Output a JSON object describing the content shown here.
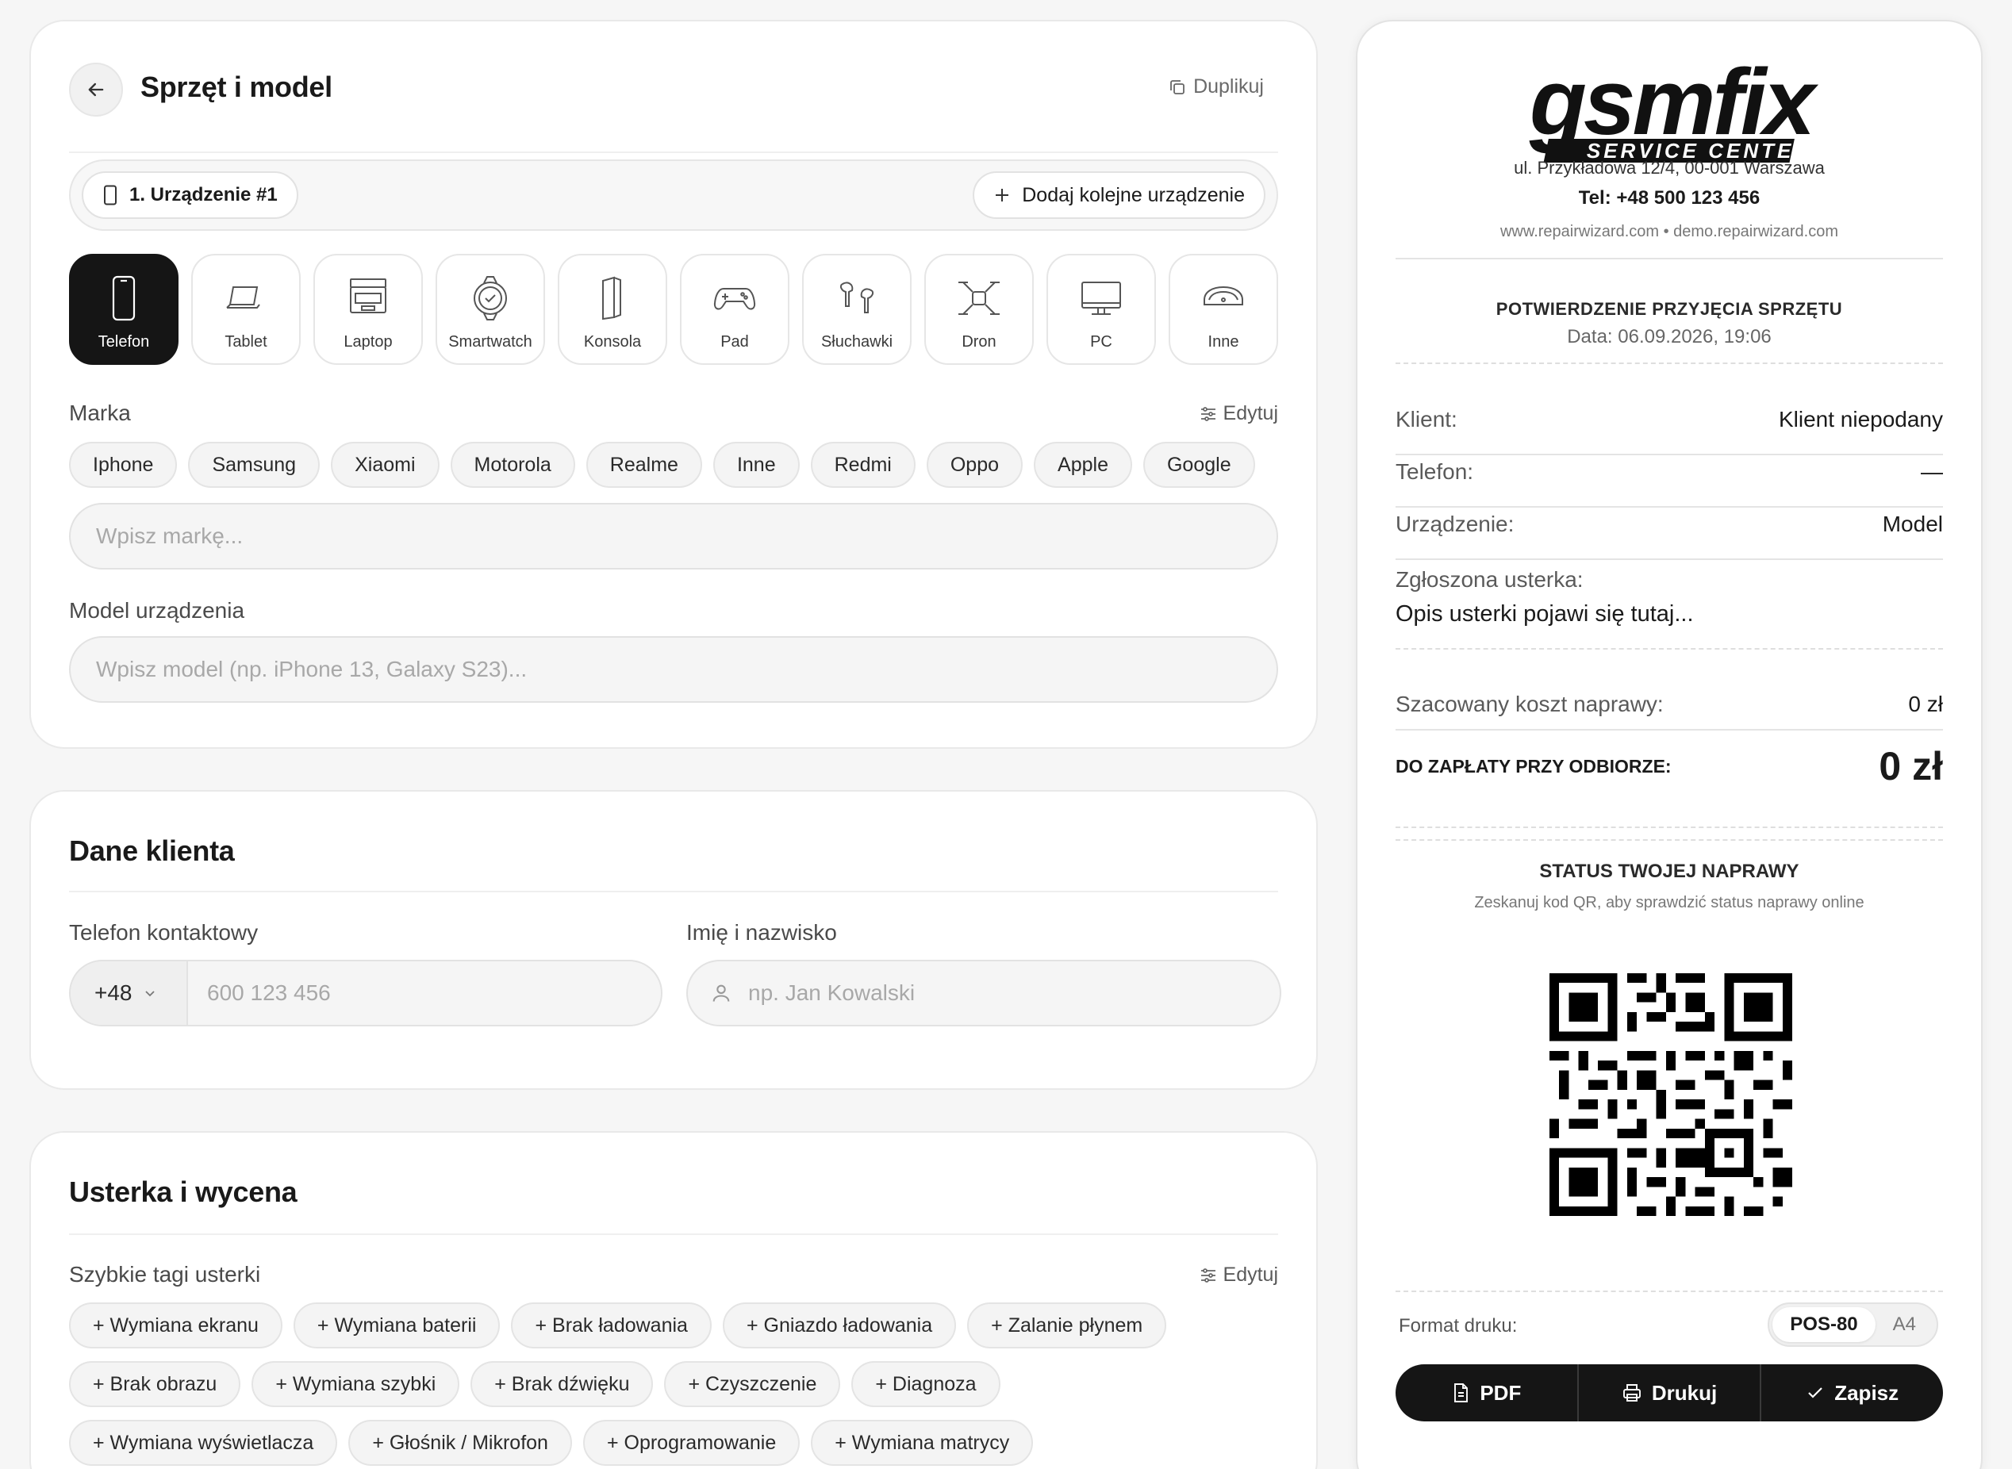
{
  "device_card": {
    "title": "Sprzęt i model",
    "duplicate_label": "Duplikuj",
    "device_chip": "1. Urządzenie #1",
    "add_device_label": "Dodaj kolejne urządzenie",
    "types": [
      {
        "label": "Telefon",
        "icon": "phone-icon",
        "active": true
      },
      {
        "label": "Tablet",
        "icon": "tablet-icon",
        "active": false
      },
      {
        "label": "Laptop",
        "icon": "laptop-icon",
        "active": false
      },
      {
        "label": "Smartwatch",
        "icon": "smartwatch-icon",
        "active": false
      },
      {
        "label": "Konsola",
        "icon": "console-icon",
        "active": false
      },
      {
        "label": "Pad",
        "icon": "gamepad-icon",
        "active": false
      },
      {
        "label": "Słuchawki",
        "icon": "earbuds-icon",
        "active": false
      },
      {
        "label": "Dron",
        "icon": "drone-icon",
        "active": false
      },
      {
        "label": "PC",
        "icon": "monitor-icon",
        "active": false
      },
      {
        "label": "Inne",
        "icon": "other-device-icon",
        "active": false
      }
    ],
    "brand_label": "Marka",
    "brand_edit": "Edytuj",
    "brands": [
      "Iphone",
      "Samsung",
      "Xiaomi",
      "Motorola",
      "Realme",
      "Inne",
      "Redmi",
      "Oppo",
      "Apple",
      "Google"
    ],
    "brand_placeholder": "Wpisz markę...",
    "model_label": "Model urządzenia",
    "model_placeholder": "Wpisz model (np. iPhone 13, Galaxy S23)..."
  },
  "client_card": {
    "title": "Dane klienta",
    "phone_label": "Telefon kontaktowy",
    "phone_prefix": "+48",
    "phone_placeholder": "600 123 456",
    "name_label": "Imię i nazwisko",
    "name_placeholder": "np. Jan Kowalski"
  },
  "fault_card": {
    "title": "Usterka i wycena",
    "tags_label": "Szybkie tagi usterki",
    "tags_edit": "Edytuj",
    "tags": [
      "+ Wymiana ekranu",
      "+ Wymiana baterii",
      "+ Brak ładowania",
      "+ Gniazdo ładowania",
      "+ Zalanie płynem",
      "+ Brak obrazu",
      "+ Wymiana szybki",
      "+ Brak dźwięku",
      "+ Czyszczenie",
      "+ Diagnoza",
      "+ Wymiana wyświetlacza",
      "+ Głośnik / Mikrofon",
      "+ Oprogramowanie",
      "+ Wymiana matrycy"
    ]
  },
  "receipt": {
    "logo_main": "gsmfix",
    "logo_sub": "SERVICE CENTER",
    "address": "ul. Przykładowa 12/4, 00-001 Warszawa",
    "phone": "Tel: +48 500 123 456",
    "websites": "www.repairwizard.com • demo.repairwizard.com",
    "doc_title": "POTWIERDZENIE PRZYJĘCIA SPRZĘTU",
    "doc_date": "Data: 06.09.2026, 19:06",
    "client_key": "Klient:",
    "client_val": "Klient niepodany",
    "phone_key": "Telefon:",
    "phone_val": "—",
    "device_key": "Urządzenie:",
    "device_val": "Model",
    "fault_key": "Zgłoszona usterka:",
    "fault_val": "Opis usterki pojawi się tutaj...",
    "cost_key": "Szacowany koszt naprawy:",
    "cost_val": "0 zł",
    "total_key": "DO ZAPŁATY PRZY ODBIORZE:",
    "total_val": "0 zł",
    "status_title": "STATUS TWOJEJ NAPRAWY",
    "status_sub": "Zeskanuj kod QR, aby sprawdzić status naprawy online",
    "format_label": "Format druku:",
    "format_options": [
      "POS-80",
      "A4"
    ],
    "format_selected": "POS-80",
    "actions": {
      "pdf": "PDF",
      "print": "Drukuj",
      "save": "Zapisz"
    }
  }
}
